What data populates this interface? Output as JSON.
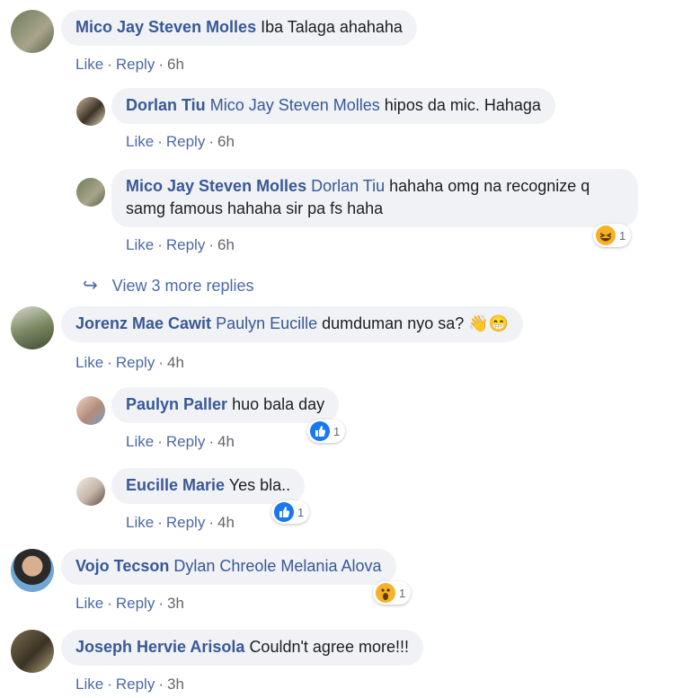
{
  "actions": {
    "like": "Like",
    "reply": "Reply",
    "sep": "·"
  },
  "comments": [
    {
      "author": "Mico Jay Steven Molles",
      "mention": "",
      "text": "Iba Talaga ahahaha",
      "time": "6h"
    },
    {
      "author": "Dorlan Tiu",
      "mention": "Mico Jay Steven Molles",
      "text": "hipos da mic. Hahaga",
      "time": "6h"
    },
    {
      "author": "Mico Jay Steven Molles",
      "mention": "Dorlan Tiu",
      "text": "hahaha omg na recognize q samg famous hahaha sir pa fs haha",
      "time": "6h",
      "reaction": {
        "icon": "haha-reaction-icon",
        "count": "1"
      }
    },
    {
      "author": "Jorenz Mae Cawit",
      "mention": "Paulyn Eucille",
      "text": "dumduman nyo sa? 👋😁",
      "time": "4h"
    },
    {
      "author": "Paulyn Paller",
      "mention": "",
      "text": "huo bala day",
      "time": "4h",
      "reaction": {
        "icon": "like-reaction-icon",
        "count": "1"
      }
    },
    {
      "author": "Eucille Marie",
      "mention": "",
      "text": "Yes bla..",
      "time": "4h",
      "reaction": {
        "icon": "like-reaction-icon",
        "count": "1"
      }
    },
    {
      "author": "Vojo Tecson",
      "mention": "Dylan Chreole Melania Alova",
      "text": "",
      "time": "3h",
      "reaction": {
        "icon": "wow-reaction-icon",
        "count": "1"
      }
    },
    {
      "author": "Joseph Hervie Arisola",
      "mention": "",
      "text": "Couldn't agree more!!!",
      "time": "3h"
    }
  ],
  "view_more": {
    "label": "View 3 more replies",
    "icon": "reply-arrow-icon"
  },
  "colors": {
    "link": "#385898",
    "bubble": "#f0f2f5",
    "meta": "#606770"
  }
}
